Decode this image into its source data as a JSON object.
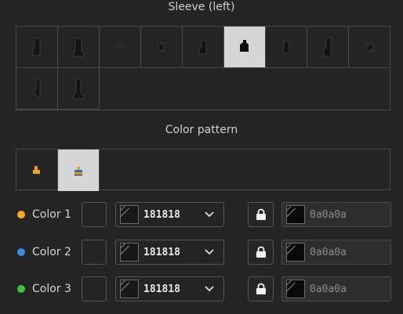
{
  "sleeve": {
    "title": "Sleeve (left)",
    "selected_index": 5
  },
  "pattern": {
    "title": "Color pattern",
    "selected_index": 1
  },
  "colors": [
    {
      "label": "Color 1",
      "dot_color": "#f5a623",
      "hex": "181818",
      "locked_hex": "0a0a0a"
    },
    {
      "label": "Color 2",
      "dot_color": "#3b8de0",
      "hex": "181818",
      "locked_hex": "0a0a0a"
    },
    {
      "label": "Color 3",
      "dot_color": "#3cc43c",
      "hex": "181818",
      "locked_hex": "0a0a0a"
    }
  ],
  "icons": {
    "dropdown": "chevron-down-icon",
    "lock": "lock-icon"
  }
}
